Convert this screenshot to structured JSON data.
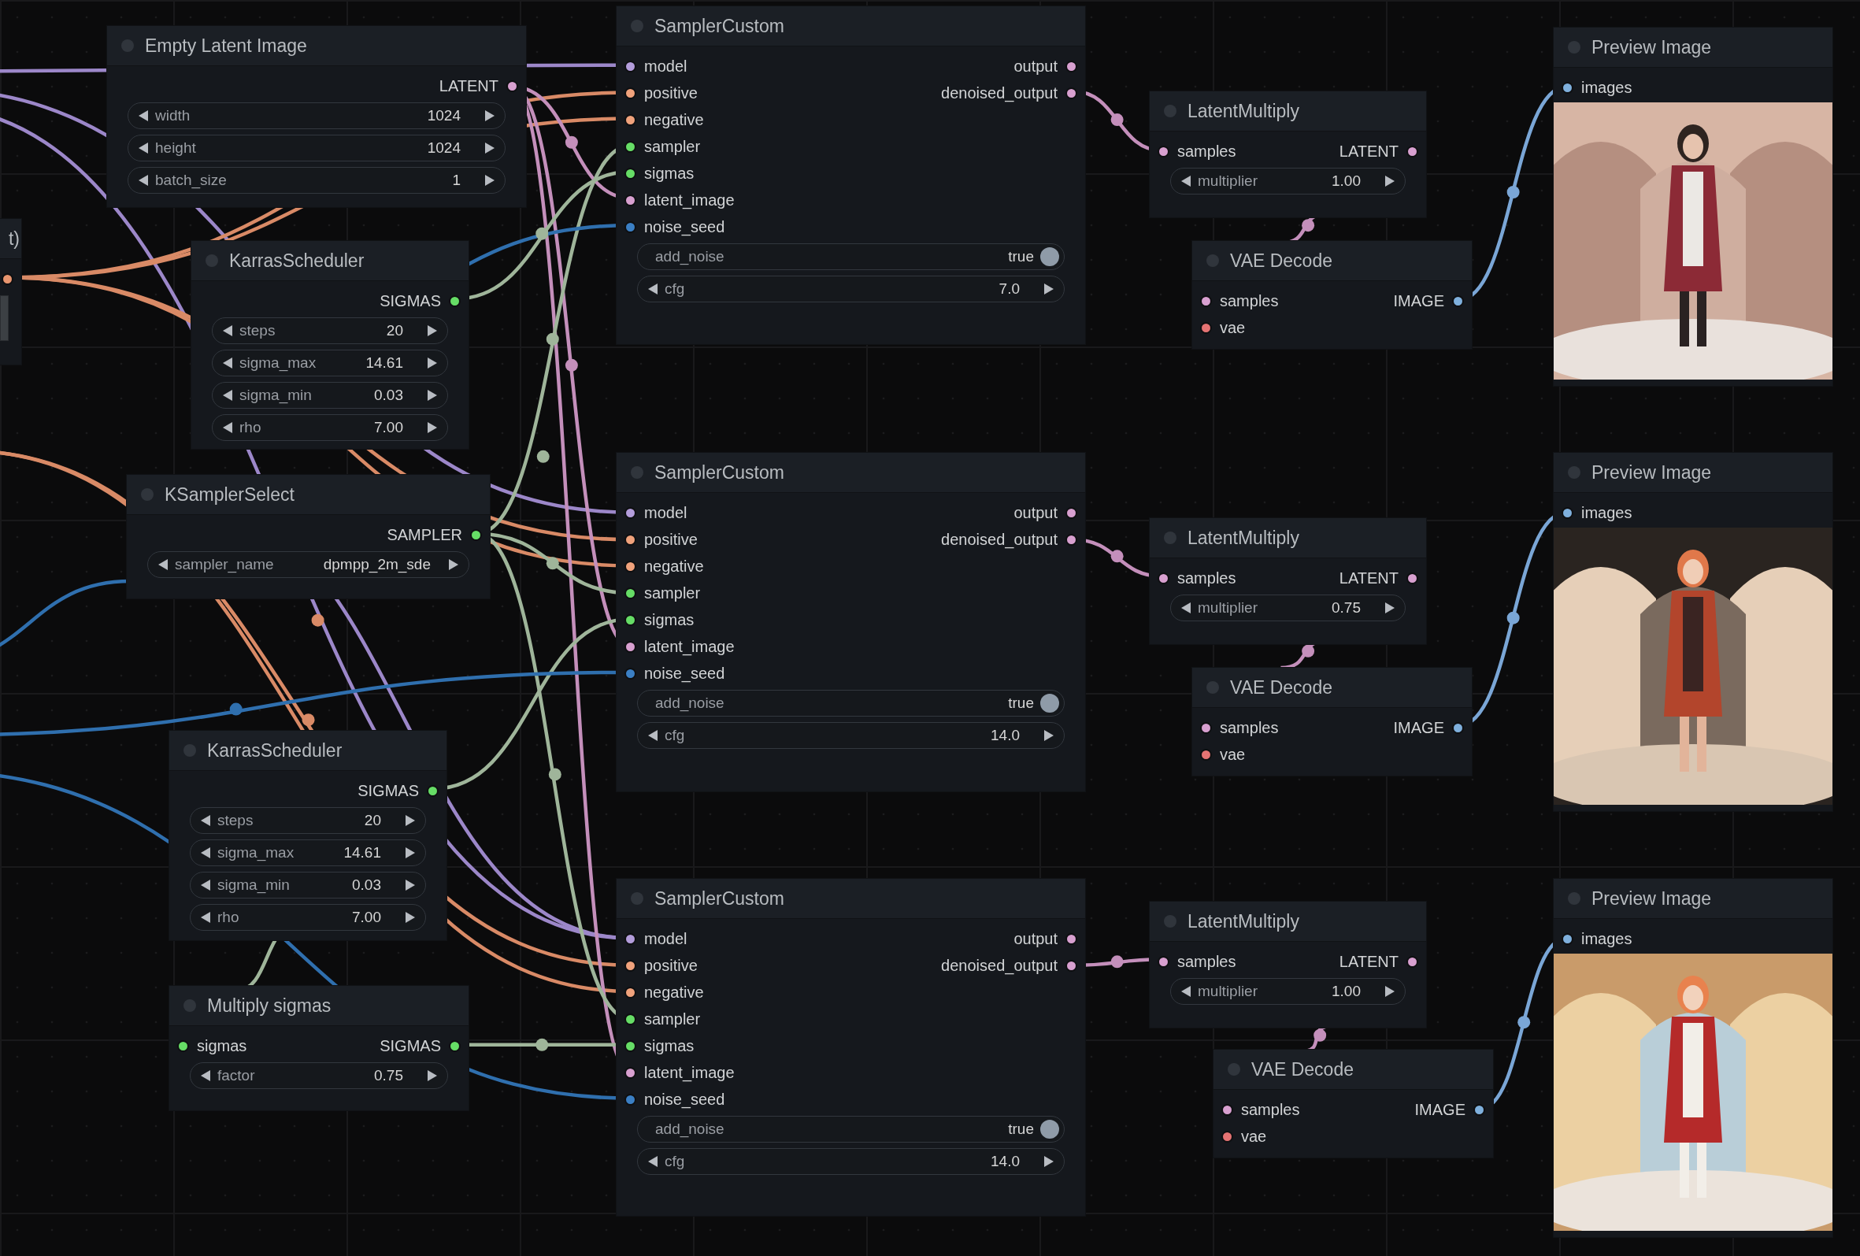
{
  "nodes": [
    {
      "kind": "clipped",
      "title": "t)",
      "outputs": [
        {
          "color": "#e8956f"
        }
      ],
      "widgets": [
        {
          "kind": "stub"
        }
      ]
    },
    {
      "kind": "node",
      "title": "Empty Latent Image",
      "outputs": [
        {
          "label": "LATENT",
          "color": "#d8a0d0"
        }
      ],
      "widgets": [
        {
          "kind": "number",
          "label": "width",
          "value": "1024"
        },
        {
          "kind": "number",
          "label": "height",
          "value": "1024"
        },
        {
          "kind": "number",
          "label": "batch_size",
          "value": "1"
        }
      ]
    },
    {
      "kind": "node",
      "title": "SamplerCustom",
      "inputs": [
        {
          "label": "model",
          "color": "#b39ddb"
        },
        {
          "label": "positive",
          "color": "#f0a27c"
        },
        {
          "label": "negative",
          "color": "#f0a27c"
        },
        {
          "label": "sampler",
          "color": "#66dd66"
        },
        {
          "label": "sigmas",
          "color": "#66dd66"
        },
        {
          "label": "latent_image",
          "color": "#d8a0d0"
        },
        {
          "label": "noise_seed",
          "color": "#3b7fc4"
        }
      ],
      "outputs": [
        {
          "label": "output",
          "color": "#d8a0d0"
        },
        {
          "label": "denoised_output",
          "color": "#d8a0d0"
        }
      ],
      "widgets": [
        {
          "kind": "toggle",
          "label": "add_noise",
          "value": "true",
          "on": true
        },
        {
          "kind": "number",
          "label": "cfg",
          "value": "7.0"
        }
      ]
    },
    {
      "kind": "node",
      "title": "LatentMultiply",
      "inputs": [
        {
          "label": "samples",
          "color": "#d8a0d0"
        }
      ],
      "outputs": [
        {
          "label": "LATENT",
          "color": "#d8a0d0"
        }
      ],
      "widgets": [
        {
          "kind": "number",
          "label": "multiplier",
          "value": "1.00"
        }
      ]
    },
    {
      "kind": "node",
      "title": "Preview Image",
      "inputs": [
        {
          "label": "images",
          "color": "#7fb0dd"
        }
      ],
      "image": {
        "kind": "picture"
      }
    },
    {
      "kind": "node",
      "title": "KarrasScheduler",
      "outputs": [
        {
          "label": "SIGMAS",
          "color": "#66dd66"
        }
      ],
      "widgets": [
        {
          "kind": "number",
          "label": "steps",
          "value": "20"
        },
        {
          "kind": "number",
          "label": "sigma_max",
          "value": "14.61"
        },
        {
          "kind": "number",
          "label": "sigma_min",
          "value": "0.03"
        },
        {
          "kind": "number",
          "label": "rho",
          "value": "7.00"
        }
      ]
    },
    {
      "kind": "node",
      "title": "VAE Decode",
      "inputs": [
        {
          "label": "samples",
          "color": "#d8a0d0"
        },
        {
          "label": "vae",
          "color": "#e57373"
        }
      ],
      "outputs": [
        {
          "label": "IMAGE",
          "color": "#7fb0dd"
        }
      ]
    },
    {
      "kind": "node",
      "title": "KSamplerSelect",
      "outputs": [
        {
          "label": "SAMPLER",
          "color": "#66dd66"
        }
      ],
      "widgets": [
        {
          "kind": "combo",
          "label": "sampler_name",
          "value": "dpmpp_2m_sde"
        }
      ]
    },
    {
      "kind": "node",
      "title": "SamplerCustom",
      "inputs": [
        {
          "label": "model",
          "color": "#b39ddb"
        },
        {
          "label": "positive",
          "color": "#f0a27c"
        },
        {
          "label": "negative",
          "color": "#f0a27c"
        },
        {
          "label": "sampler",
          "color": "#66dd66"
        },
        {
          "label": "sigmas",
          "color": "#66dd66"
        },
        {
          "label": "latent_image",
          "color": "#d8a0d0"
        },
        {
          "label": "noise_seed",
          "color": "#3b7fc4"
        }
      ],
      "outputs": [
        {
          "label": "output",
          "color": "#d8a0d0"
        },
        {
          "label": "denoised_output",
          "color": "#d8a0d0"
        }
      ],
      "widgets": [
        {
          "kind": "toggle",
          "label": "add_noise",
          "value": "true",
          "on": true
        },
        {
          "kind": "number",
          "label": "cfg",
          "value": "14.0"
        }
      ]
    },
    {
      "kind": "node",
      "title": "LatentMultiply",
      "inputs": [
        {
          "label": "samples",
          "color": "#d8a0d0"
        }
      ],
      "outputs": [
        {
          "label": "LATENT",
          "color": "#d8a0d0"
        }
      ],
      "widgets": [
        {
          "kind": "number",
          "label": "multiplier",
          "value": "0.75"
        }
      ]
    },
    {
      "kind": "node",
      "title": "Preview Image",
      "inputs": [
        {
          "label": "images",
          "color": "#7fb0dd"
        }
      ],
      "image": {
        "kind": "picture"
      }
    },
    {
      "kind": "node",
      "title": "VAE Decode",
      "inputs": [
        {
          "label": "samples",
          "color": "#d8a0d0"
        },
        {
          "label": "vae",
          "color": "#e57373"
        }
      ],
      "outputs": [
        {
          "label": "IMAGE",
          "color": "#7fb0dd"
        }
      ]
    },
    {
      "kind": "node",
      "title": "KarrasScheduler",
      "outputs": [
        {
          "label": "SIGMAS",
          "color": "#66dd66"
        }
      ],
      "widgets": [
        {
          "kind": "number",
          "label": "steps",
          "value": "20"
        },
        {
          "kind": "number",
          "label": "sigma_max",
          "value": "14.61"
        },
        {
          "kind": "number",
          "label": "sigma_min",
          "value": "0.03"
        },
        {
          "kind": "number",
          "label": "rho",
          "value": "7.00"
        }
      ]
    },
    {
      "kind": "node",
      "title": "SamplerCustom",
      "inputs": [
        {
          "label": "model",
          "color": "#b39ddb"
        },
        {
          "label": "positive",
          "color": "#f0a27c"
        },
        {
          "label": "negative",
          "color": "#f0a27c"
        },
        {
          "label": "sampler",
          "color": "#66dd66"
        },
        {
          "label": "sigmas",
          "color": "#66dd66"
        },
        {
          "label": "latent_image",
          "color": "#d8a0d0"
        },
        {
          "label": "noise_seed",
          "color": "#3b7fc4"
        }
      ],
      "outputs": [
        {
          "label": "output",
          "color": "#d8a0d0"
        },
        {
          "label": "denoised_output",
          "color": "#d8a0d0"
        }
      ],
      "widgets": [
        {
          "kind": "toggle",
          "label": "add_noise",
          "value": "true",
          "on": true
        },
        {
          "kind": "number",
          "label": "cfg",
          "value": "14.0"
        }
      ]
    },
    {
      "kind": "node",
      "title": "LatentMultiply",
      "inputs": [
        {
          "label": "samples",
          "color": "#d8a0d0"
        }
      ],
      "outputs": [
        {
          "label": "LATENT",
          "color": "#d8a0d0"
        }
      ],
      "widgets": [
        {
          "kind": "number",
          "label": "multiplier",
          "value": "1.00"
        }
      ]
    },
    {
      "kind": "node",
      "title": "Preview Image",
      "inputs": [
        {
          "label": "images",
          "color": "#7fb0dd"
        }
      ],
      "image": {
        "kind": "picture"
      }
    },
    {
      "kind": "node",
      "title": "Multiply sigmas",
      "inputs": [
        {
          "label": "sigmas",
          "color": "#66dd66"
        }
      ],
      "outputs": [
        {
          "label": "SIGMAS",
          "color": "#66dd66"
        }
      ],
      "widgets": [
        {
          "kind": "number",
          "label": "factor",
          "value": "0.75"
        }
      ]
    },
    {
      "kind": "node",
      "title": "VAE Decode",
      "inputs": [
        {
          "label": "samples",
          "color": "#d8a0d0"
        },
        {
          "label": "vae",
          "color": "#e57373"
        }
      ],
      "outputs": [
        {
          "label": "IMAGE",
          "color": "#7fb0dd"
        }
      ]
    }
  ]
}
